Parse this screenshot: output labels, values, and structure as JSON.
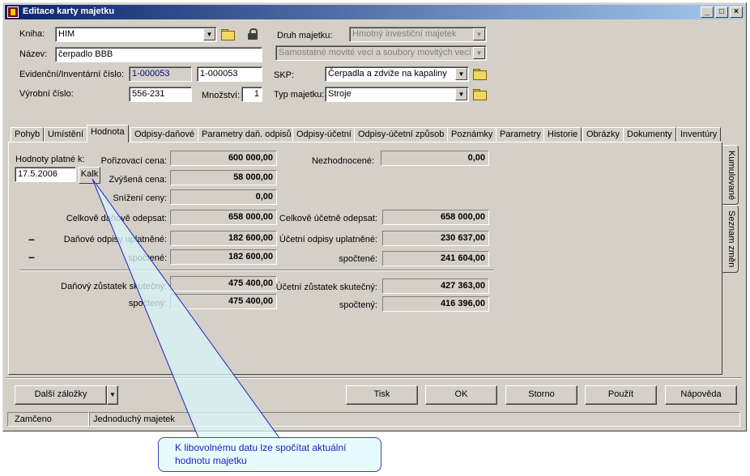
{
  "window": {
    "title": "Editace karty majetku"
  },
  "form": {
    "kniha": {
      "label": "Kniha:",
      "value": "HIM"
    },
    "druh": {
      "label": "Druh majetku:",
      "value": "Hmotný investiční majetek",
      "sub_value": "Samostatné movité veci a soubory movitých vecí"
    },
    "nazev": {
      "label": "Název:",
      "value": "čerpadlo BBB"
    },
    "evidencni": {
      "label": "Evidenční/Inventární číslo:",
      "value": "1-000053",
      "value2": "1-000053"
    },
    "skp": {
      "label": "SKP:",
      "value": "Čerpadla a zdviže na kapaliny"
    },
    "vyrobni": {
      "label": "Výrobní číslo:",
      "value": "556-231"
    },
    "mnozstvi": {
      "label": "Množství:",
      "value": "1"
    },
    "typ": {
      "label": "Typ majetku:",
      "value": "Stroje"
    }
  },
  "tabs": [
    {
      "label": "Pohyb"
    },
    {
      "label": "Umístění"
    },
    {
      "label": "Hodnota"
    },
    {
      "label": "Odpisy-daňové"
    },
    {
      "label": "Parametry daň. odpisů"
    },
    {
      "label": "Odpisy-účetní"
    },
    {
      "label": "Odpisy-účetní způsob"
    },
    {
      "label": "Poznámky"
    },
    {
      "label": "Parametry"
    },
    {
      "label": "Historie"
    },
    {
      "label": "Obrázky"
    },
    {
      "label": "Dokumenty"
    },
    {
      "label": "Inventúry"
    }
  ],
  "vtabs": [
    {
      "label": "Kumulované"
    },
    {
      "label": "Seznam změn"
    }
  ],
  "hodnota": {
    "date_label": "Hodnoty platné k:",
    "date_value": "17.5.2006",
    "calc_button": "Kalk",
    "porizovaci": {
      "label": "Pořizovací cena:",
      "value": "600 000,00"
    },
    "zvysena": {
      "label": "Zvýšená cena:",
      "value": "58 000,00"
    },
    "snizeni": {
      "label": "Snížení ceny:",
      "value": "0,00"
    },
    "nezhodnocene": {
      "label": "Nezhodnocené:",
      "value": "0,00"
    },
    "celk_danove": {
      "label": "Celkově daňově odepsat:",
      "value": "658 000,00"
    },
    "celk_ucetne": {
      "label": "Celkově účetně odepsat:",
      "value": "658 000,00"
    },
    "dan_uplatnene": {
      "label": "Daňové odpisy uplatněné:",
      "value": "182 600,00"
    },
    "uc_uplatnene": {
      "label": "Účetní odpisy uplatněné:",
      "value": "230 637,00"
    },
    "dan_spoctene": {
      "label": "spočtené:",
      "value": "182 600,00"
    },
    "uc_spoctene": {
      "label": "spočtené:",
      "value": "241 604,00"
    },
    "dan_zustatek": {
      "label": "Daňový zůstatek skutečný:",
      "value": "475 400,00"
    },
    "uc_zustatek": {
      "label": "Účetní zůstatek skutečný:",
      "value": "427 363,00"
    },
    "dan_zust_spocteny": {
      "label": "spočtený:",
      "value": "475 400,00"
    },
    "uc_zust_spocteny": {
      "label": "spočtený:",
      "value": "416 396,00"
    },
    "minus": "–"
  },
  "buttons": {
    "dalsi": "Další záložky",
    "tisk": "Tisk",
    "ok": "OK",
    "storno": "Storno",
    "pouzit": "Použít",
    "napoveda": "Nápověda"
  },
  "status": {
    "left": "Zamčeno",
    "right": "Jednoduchý majetek"
  },
  "callout": {
    "text": "K libovolnému datu lze spočítat aktuální hodnotu majetku"
  },
  "colors": {
    "title_bar": "#0a246a",
    "face": "#d4d0c8",
    "callout_bg": "#e6fbfd",
    "callout_text": "#2020c0"
  }
}
